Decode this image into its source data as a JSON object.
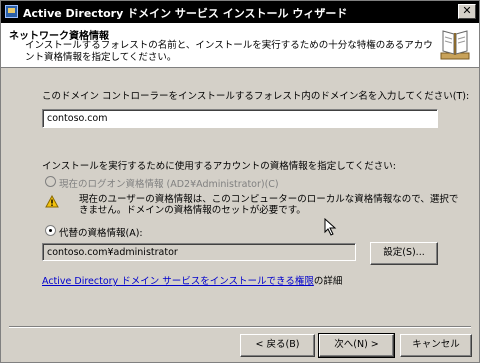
{
  "window": {
    "title": "Active Directory ドメイン サービス インストール ウィザード"
  },
  "header": {
    "title": "ネットワーク資格情報",
    "description": "インストールするフォレストの名前と、インストールを実行するための十分な特権のあるアカウント資格情報を指定してください。"
  },
  "domain": {
    "label": "このドメイン コントローラーをインストールするフォレスト内のドメイン名を入力してください(T):",
    "value": "contoso.com"
  },
  "credentials": {
    "label": "インストールを実行するために使用するアカウントの資格情報を指定してください:",
    "current_option": "現在のログオン資格情報 (AD2¥Administrator)(C)",
    "warning": "現在のユーザーの資格情報は、このコンピューターのローカルな資格情報なので、選択できません。ドメインの資格情報のセットが必要です。",
    "alternate_option": "代替の資格情報(A):",
    "alternate_value": "contoso.com¥administrator",
    "set_button": "設定(S)..."
  },
  "link": {
    "text": "Active Directory ドメイン サービスをインストールできる権限",
    "suffix": "の詳細"
  },
  "footer": {
    "back_button": "< 戻る(B)",
    "next_button": "次へ(N) >",
    "cancel_button": "キャンセル"
  },
  "colors": {
    "link": "#0000cc",
    "dialog": "#d4d0c8"
  }
}
